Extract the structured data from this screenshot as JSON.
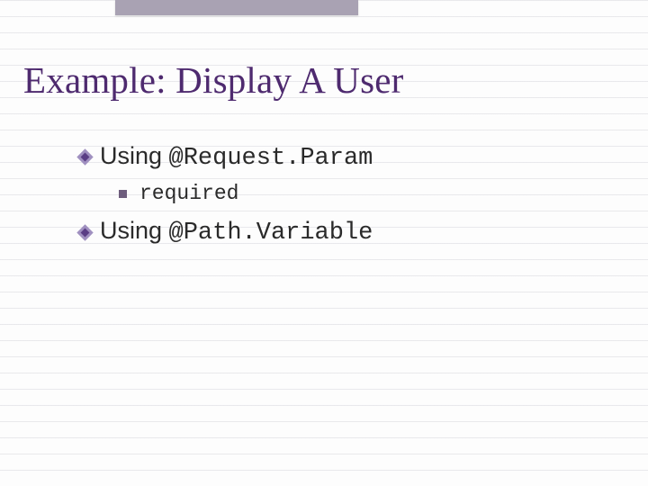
{
  "title": "Example: Display A User",
  "items": [
    {
      "prefix": "Using ",
      "code": "@Request.Param",
      "sub": [
        "required"
      ]
    },
    {
      "prefix": "Using ",
      "code": "@Path.Variable"
    }
  ]
}
